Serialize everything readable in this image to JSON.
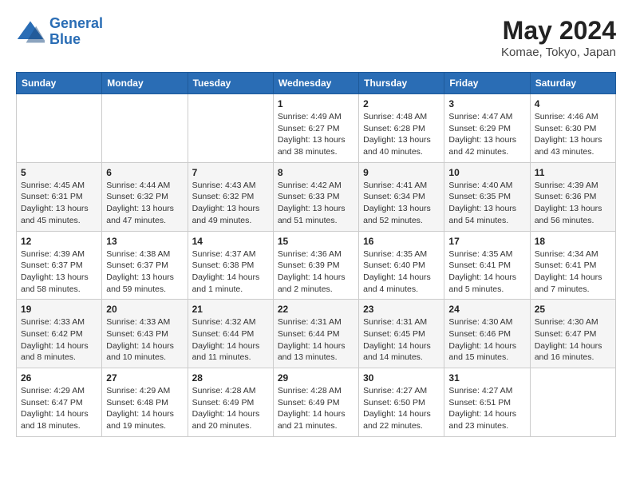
{
  "logo": {
    "line1": "General",
    "line2": "Blue"
  },
  "title": "May 2024",
  "subtitle": "Komae, Tokyo, Japan",
  "weekdays": [
    "Sunday",
    "Monday",
    "Tuesday",
    "Wednesday",
    "Thursday",
    "Friday",
    "Saturday"
  ],
  "weeks": [
    [
      {
        "day": "",
        "info": ""
      },
      {
        "day": "",
        "info": ""
      },
      {
        "day": "",
        "info": ""
      },
      {
        "day": "1",
        "info": "Sunrise: 4:49 AM\nSunset: 6:27 PM\nDaylight: 13 hours\nand 38 minutes."
      },
      {
        "day": "2",
        "info": "Sunrise: 4:48 AM\nSunset: 6:28 PM\nDaylight: 13 hours\nand 40 minutes."
      },
      {
        "day": "3",
        "info": "Sunrise: 4:47 AM\nSunset: 6:29 PM\nDaylight: 13 hours\nand 42 minutes."
      },
      {
        "day": "4",
        "info": "Sunrise: 4:46 AM\nSunset: 6:30 PM\nDaylight: 13 hours\nand 43 minutes."
      }
    ],
    [
      {
        "day": "5",
        "info": "Sunrise: 4:45 AM\nSunset: 6:31 PM\nDaylight: 13 hours\nand 45 minutes."
      },
      {
        "day": "6",
        "info": "Sunrise: 4:44 AM\nSunset: 6:32 PM\nDaylight: 13 hours\nand 47 minutes."
      },
      {
        "day": "7",
        "info": "Sunrise: 4:43 AM\nSunset: 6:32 PM\nDaylight: 13 hours\nand 49 minutes."
      },
      {
        "day": "8",
        "info": "Sunrise: 4:42 AM\nSunset: 6:33 PM\nDaylight: 13 hours\nand 51 minutes."
      },
      {
        "day": "9",
        "info": "Sunrise: 4:41 AM\nSunset: 6:34 PM\nDaylight: 13 hours\nand 52 minutes."
      },
      {
        "day": "10",
        "info": "Sunrise: 4:40 AM\nSunset: 6:35 PM\nDaylight: 13 hours\nand 54 minutes."
      },
      {
        "day": "11",
        "info": "Sunrise: 4:39 AM\nSunset: 6:36 PM\nDaylight: 13 hours\nand 56 minutes."
      }
    ],
    [
      {
        "day": "12",
        "info": "Sunrise: 4:39 AM\nSunset: 6:37 PM\nDaylight: 13 hours\nand 58 minutes."
      },
      {
        "day": "13",
        "info": "Sunrise: 4:38 AM\nSunset: 6:37 PM\nDaylight: 13 hours\nand 59 minutes."
      },
      {
        "day": "14",
        "info": "Sunrise: 4:37 AM\nSunset: 6:38 PM\nDaylight: 14 hours\nand 1 minute."
      },
      {
        "day": "15",
        "info": "Sunrise: 4:36 AM\nSunset: 6:39 PM\nDaylight: 14 hours\nand 2 minutes."
      },
      {
        "day": "16",
        "info": "Sunrise: 4:35 AM\nSunset: 6:40 PM\nDaylight: 14 hours\nand 4 minutes."
      },
      {
        "day": "17",
        "info": "Sunrise: 4:35 AM\nSunset: 6:41 PM\nDaylight: 14 hours\nand 5 minutes."
      },
      {
        "day": "18",
        "info": "Sunrise: 4:34 AM\nSunset: 6:41 PM\nDaylight: 14 hours\nand 7 minutes."
      }
    ],
    [
      {
        "day": "19",
        "info": "Sunrise: 4:33 AM\nSunset: 6:42 PM\nDaylight: 14 hours\nand 8 minutes."
      },
      {
        "day": "20",
        "info": "Sunrise: 4:33 AM\nSunset: 6:43 PM\nDaylight: 14 hours\nand 10 minutes."
      },
      {
        "day": "21",
        "info": "Sunrise: 4:32 AM\nSunset: 6:44 PM\nDaylight: 14 hours\nand 11 minutes."
      },
      {
        "day": "22",
        "info": "Sunrise: 4:31 AM\nSunset: 6:44 PM\nDaylight: 14 hours\nand 13 minutes."
      },
      {
        "day": "23",
        "info": "Sunrise: 4:31 AM\nSunset: 6:45 PM\nDaylight: 14 hours\nand 14 minutes."
      },
      {
        "day": "24",
        "info": "Sunrise: 4:30 AM\nSunset: 6:46 PM\nDaylight: 14 hours\nand 15 minutes."
      },
      {
        "day": "25",
        "info": "Sunrise: 4:30 AM\nSunset: 6:47 PM\nDaylight: 14 hours\nand 16 minutes."
      }
    ],
    [
      {
        "day": "26",
        "info": "Sunrise: 4:29 AM\nSunset: 6:47 PM\nDaylight: 14 hours\nand 18 minutes."
      },
      {
        "day": "27",
        "info": "Sunrise: 4:29 AM\nSunset: 6:48 PM\nDaylight: 14 hours\nand 19 minutes."
      },
      {
        "day": "28",
        "info": "Sunrise: 4:28 AM\nSunset: 6:49 PM\nDaylight: 14 hours\nand 20 minutes."
      },
      {
        "day": "29",
        "info": "Sunrise: 4:28 AM\nSunset: 6:49 PM\nDaylight: 14 hours\nand 21 minutes."
      },
      {
        "day": "30",
        "info": "Sunrise: 4:27 AM\nSunset: 6:50 PM\nDaylight: 14 hours\nand 22 minutes."
      },
      {
        "day": "31",
        "info": "Sunrise: 4:27 AM\nSunset: 6:51 PM\nDaylight: 14 hours\nand 23 minutes."
      },
      {
        "day": "",
        "info": ""
      }
    ]
  ]
}
